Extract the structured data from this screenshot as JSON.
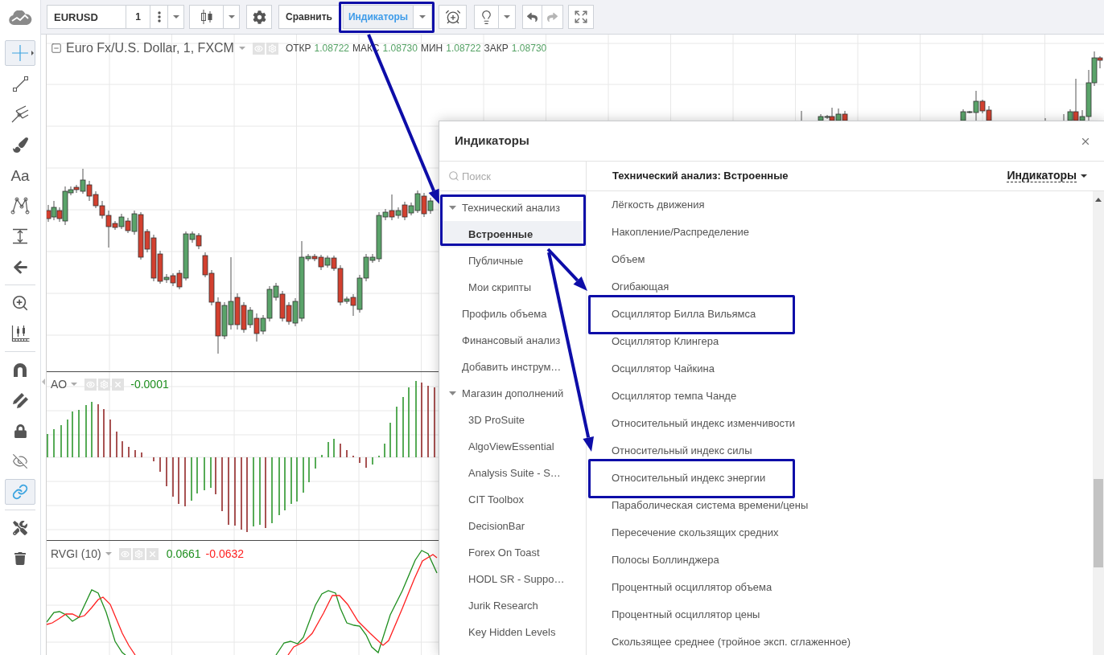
{
  "sidebar": {
    "groups": [
      {
        "tools": [
          {
            "kind": "crosshair",
            "selected": true
          },
          {
            "kind": "trendline",
            "selected": false
          },
          {
            "kind": "pitchfork",
            "selected": false
          },
          {
            "kind": "brush",
            "selected": false
          },
          {
            "kind": "text",
            "glyph": "Aa",
            "selected": false
          },
          {
            "kind": "pattern",
            "selected": false
          },
          {
            "kind": "measure",
            "selected": false
          },
          {
            "kind": "arrow",
            "selected": false
          }
        ]
      },
      {
        "tools": [
          {
            "kind": "zoom",
            "selected": false
          },
          {
            "kind": "ruler",
            "selected": false
          }
        ]
      },
      {
        "tools": [
          {
            "kind": "magnet",
            "selected": false
          },
          {
            "kind": "pencils",
            "selected": false
          },
          {
            "kind": "lock",
            "selected": false
          },
          {
            "kind": "hide",
            "selected": false
          },
          {
            "kind": "link",
            "selected": true
          }
        ]
      },
      {
        "tools": [
          {
            "kind": "tools",
            "selected": false
          },
          {
            "kind": "trash",
            "selected": false
          }
        ]
      }
    ]
  },
  "toolbar": {
    "symbol": "EURUSD",
    "interval": "1",
    "compare": "Сравнить",
    "indicators": {
      "label": "Индикаторы",
      "selected": true,
      "highlighted": true
    },
    "undo": {
      "disabled": false
    },
    "redo": {
      "disabled": true
    }
  },
  "main_pane": {
    "title": "Euro Fx/U.S. Dollar, 1, FXCM",
    "ohlc": [
      {
        "label": "ОТКР",
        "value": "1.08722"
      },
      {
        "label": "МАКС",
        "value": "1.08730"
      },
      {
        "label": "МИН",
        "value": "1.08722"
      },
      {
        "label": "ЗАКР",
        "value": "1.08730"
      }
    ]
  },
  "ao_pane": {
    "title": "AO",
    "values": [
      {
        "text": "-0.0001",
        "color": "#1f8f1f"
      }
    ]
  },
  "rvgi_pane": {
    "title": "RVGI (10)",
    "values": [
      {
        "text": "0.0661",
        "color": "#1f8f1f"
      },
      {
        "text": "-0.0632",
        "color": "#ff2020"
      }
    ]
  },
  "dialog": {
    "title": "Индикаторы",
    "search": {
      "placeholder": "Поиск"
    },
    "categories": [
      {
        "label": "Технический анализ",
        "selected": false,
        "expanded": true,
        "highlighted": true,
        "children": [
          {
            "label": "Встроенные",
            "selected": true
          },
          {
            "label": "Публичные",
            "selected": false
          },
          {
            "label": "Мои скрипты",
            "selected": false
          }
        ]
      },
      {
        "label": "Профиль объема",
        "selected": false
      },
      {
        "label": "Финансовый анализ",
        "selected": false
      },
      {
        "label": "Добавить инструм…",
        "selected": false
      },
      {
        "label": "Магазин дополнений",
        "selected": false,
        "expanded": true,
        "highlighted": false,
        "children": [
          {
            "label": "3D ProSuite",
            "selected": false
          },
          {
            "label": "AlgoViewEssential",
            "selected": false
          },
          {
            "label": "Analysis Suite - S…",
            "selected": false
          },
          {
            "label": "CIT Toolbox",
            "selected": false
          },
          {
            "label": "DecisionBar",
            "selected": false
          },
          {
            "label": "Forex On Toast",
            "selected": false
          },
          {
            "label": "HODL SR - Suppo…",
            "selected": false
          },
          {
            "label": "Jurik Research",
            "selected": false
          },
          {
            "label": "Key Hidden Levels",
            "selected": false
          }
        ]
      }
    ],
    "list_title": "Технический анализ: Встроенные",
    "list_filter": "Индикаторы",
    "items": [
      {
        "label": "Лёгкость движения",
        "highlighted": false
      },
      {
        "label": "Накопление/Распределение",
        "highlighted": false
      },
      {
        "label": "Объем",
        "highlighted": false
      },
      {
        "label": "Огибающая",
        "highlighted": false
      },
      {
        "label": "Осциллятор Билла Вильямса",
        "highlighted": true
      },
      {
        "label": "Осциллятор Клингера",
        "highlighted": false
      },
      {
        "label": "Осциллятор Чайкина",
        "highlighted": false
      },
      {
        "label": "Осциллятор темпа Чанде",
        "highlighted": false
      },
      {
        "label": "Относительный индекс изменчивости",
        "highlighted": false
      },
      {
        "label": "Относительный индекс силы",
        "highlighted": false
      },
      {
        "label": "Относительный индекс энергии",
        "highlighted": true
      },
      {
        "label": "Параболическая система времени/цены",
        "highlighted": false
      },
      {
        "label": "Пересечение скользящих средних",
        "highlighted": false
      },
      {
        "label": "Полосы Боллинджера",
        "highlighted": false
      },
      {
        "label": "Процентный осциллятор объема",
        "highlighted": false
      },
      {
        "label": "Процентный осциллятор цены",
        "highlighted": false
      },
      {
        "label": "Скользящее среднее (тройное эксп. сглаженное)",
        "highlighted": false
      }
    ]
  }
}
